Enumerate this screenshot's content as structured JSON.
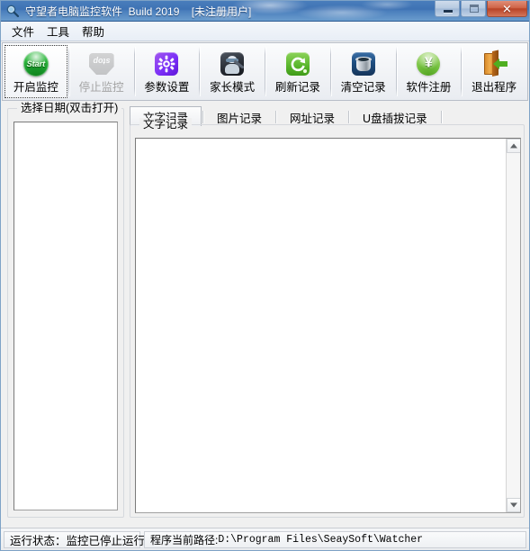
{
  "window": {
    "title": "守望者电脑监控软件  Build 2019    [未注册用户]",
    "app_icon": "magnifier-icon",
    "controls": {
      "minimize": "minimize-button",
      "maximize": "maximize-button",
      "close_label": "✕"
    }
  },
  "menubar": {
    "items": [
      {
        "label": "文件",
        "name": "menu-file"
      },
      {
        "label": "工具",
        "name": "menu-tools"
      },
      {
        "label": "帮助",
        "name": "menu-help"
      }
    ]
  },
  "toolbar": {
    "buttons": [
      {
        "label": "开启监控",
        "icon": "start-monitor-icon",
        "enabled": true,
        "focused": true
      },
      {
        "label": "停止监控",
        "icon": "stop-monitor-icon",
        "enabled": false,
        "focused": false
      },
      {
        "label": "参数设置",
        "icon": "settings-gear-icon",
        "enabled": true,
        "focused": false
      },
      {
        "label": "家长模式",
        "icon": "parent-mode-icon",
        "enabled": true,
        "focused": false
      },
      {
        "label": "刷新记录",
        "icon": "refresh-icon",
        "enabled": true,
        "focused": false
      },
      {
        "label": "清空记录",
        "icon": "trash-icon",
        "enabled": true,
        "focused": false
      },
      {
        "label": "软件注册",
        "icon": "register-yen-icon",
        "enabled": true,
        "focused": false
      },
      {
        "label": "退出程序",
        "icon": "exit-door-icon",
        "enabled": true,
        "focused": false
      }
    ]
  },
  "date_panel": {
    "group_title": "选择日期(双击打开)",
    "items": []
  },
  "tabs": [
    {
      "label": "文字记录",
      "active": true
    },
    {
      "label": "图片记录",
      "active": false
    },
    {
      "label": "网址记录",
      "active": false
    },
    {
      "label": "U盘插拔记录",
      "active": false
    }
  ],
  "record_panel": {
    "group_title": "文字记录",
    "content": ""
  },
  "statusbar": {
    "run_status": "运行状态：监控已停止运行",
    "path_label": "程序当前路径:",
    "path_value": "D:\\Program Files\\SeaySoft\\Watcher"
  },
  "colors": {
    "titlebar_blue": "#3e72b3",
    "close_red": "#b84327",
    "accent_green": "#2fb83f",
    "gear_purple": "#7b2ff7",
    "window_bg": "#f0f0f0"
  }
}
